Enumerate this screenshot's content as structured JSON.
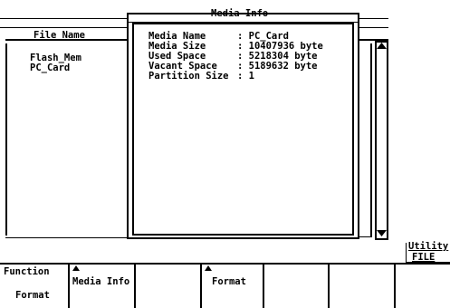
{
  "media_info": {
    "title": "Media Info",
    "rows": [
      {
        "label": "Media Name",
        "value": ": PC_Card"
      },
      {
        "label": "Media Size",
        "value": ": 10407936 byte"
      },
      {
        "label": "Used Space",
        "value": ": 5218304 byte"
      },
      {
        "label": "Vacant Space",
        "value": ": 5189632 byte"
      },
      {
        "label": "Partition Size",
        "value": ": 1"
      }
    ]
  },
  "file_panel": {
    "header": "File Name",
    "items": [
      "Flash_Mem",
      "PC_Card"
    ]
  },
  "utility": {
    "title": "Utility",
    "subtitle": "FILE"
  },
  "softkeys": {
    "function_label": "Function",
    "function_value": "Format",
    "media_info": "Media Info",
    "format": "Format"
  }
}
